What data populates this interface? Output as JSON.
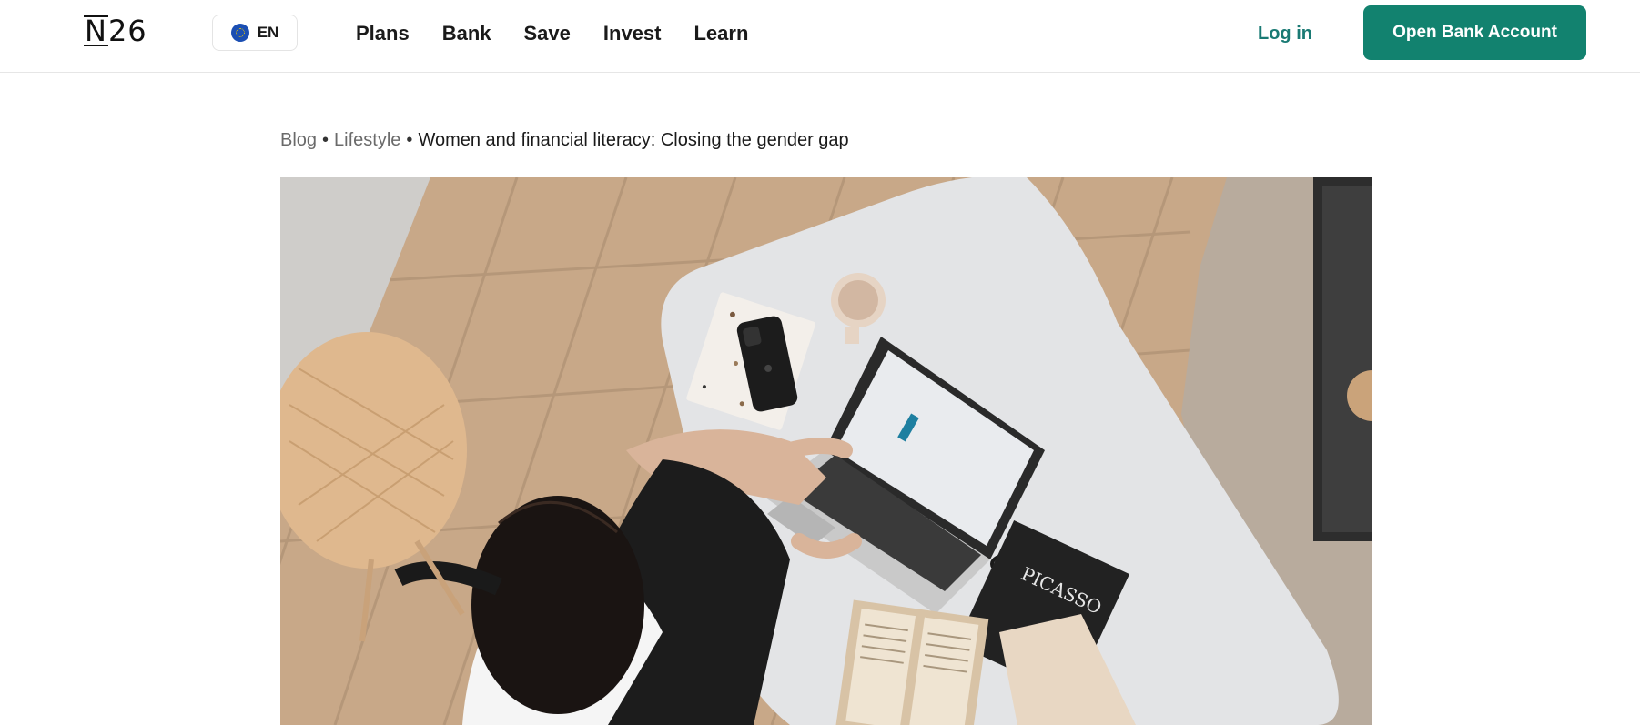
{
  "header": {
    "logo_text": "N26",
    "language": {
      "label": "EN",
      "icon": "eu-flag-icon"
    },
    "nav": [
      "Plans",
      "Bank",
      "Save",
      "Invest",
      "Learn"
    ],
    "login_label": "Log in",
    "cta_label": "Open Bank Account"
  },
  "breadcrumb": {
    "items": [
      "Blog",
      "Lifestyle"
    ],
    "separator": "•",
    "current": "Women and financial literacy: Closing the gender gap"
  },
  "hero": {
    "alt_subject": "woman-working-on-laptop-at-desk"
  },
  "colors": {
    "accent": "#12826f",
    "link": "#1a7a74",
    "text": "#1a1a1a",
    "breadcrumb_muted": "#6a6a6a"
  }
}
